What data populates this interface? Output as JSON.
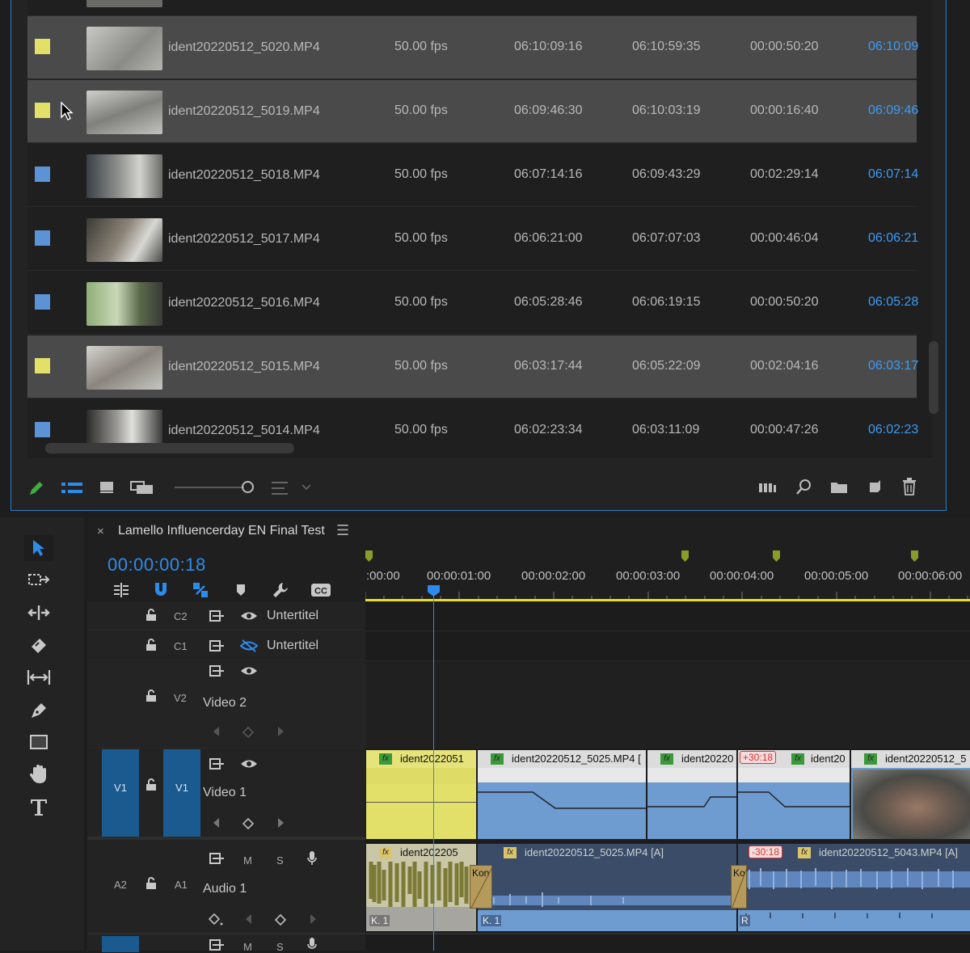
{
  "project": {
    "rows": [
      {
        "label": "yellow",
        "name": "ident20220512_5020.MP4",
        "fps": "50.00 fps",
        "media_start": "06:10:09:16",
        "media_end": "06:10:59:35",
        "duration": "00:00:50:20",
        "video_in": "06:10:09",
        "selected": true
      },
      {
        "label": "yellow",
        "name": "ident20220512_5019.MP4",
        "fps": "50.00 fps",
        "media_start": "06:09:46:30",
        "media_end": "06:10:03:19",
        "duration": "00:00:16:40",
        "video_in": "06:09:46",
        "selected": true
      },
      {
        "label": "blue",
        "name": "ident20220512_5018.MP4",
        "fps": "50.00 fps",
        "media_start": "06:07:14:16",
        "media_end": "06:09:43:29",
        "duration": "00:02:29:14",
        "video_in": "06:07:14",
        "selected": false
      },
      {
        "label": "blue",
        "name": "ident20220512_5017.MP4",
        "fps": "50.00 fps",
        "media_start": "06:06:21:00",
        "media_end": "06:07:07:03",
        "duration": "00:00:46:04",
        "video_in": "06:06:21",
        "selected": false
      },
      {
        "label": "blue",
        "name": "ident20220512_5016.MP4",
        "fps": "50.00 fps",
        "media_start": "06:05:28:46",
        "media_end": "06:06:19:15",
        "duration": "00:00:50:20",
        "video_in": "06:05:28",
        "selected": false
      },
      {
        "label": "yellow",
        "name": "ident20220512_5015.MP4",
        "fps": "50.00 fps",
        "media_start": "06:03:17:44",
        "media_end": "06:05:22:09",
        "duration": "00:02:04:16",
        "video_in": "06:03:17",
        "selected": true
      },
      {
        "label": "blue",
        "name": "ident20220512_5014.MP4",
        "fps": "50.00 fps",
        "media_start": "06:02:23:34",
        "media_end": "06:03:11:09",
        "duration": "00:00:47:26",
        "video_in": "06:02:23",
        "selected": false
      }
    ],
    "colors": {
      "yellow": "#e3e06a",
      "blue": "#5b93d6",
      "accent": "#2d8ceb"
    }
  },
  "sequence": {
    "title": "Lamello Influencerday EN Final Test",
    "close": "×",
    "menu": "☰",
    "timecode": "00:00:00:18",
    "ruler": [
      ":00:00",
      "00:00:01:00",
      "00:00:02:00",
      "00:00:03:00",
      "00:00:04:00",
      "00:00:05:00",
      "00:00:06:00"
    ]
  },
  "tracks": {
    "c2": {
      "id": "C2",
      "name": "Untertitel"
    },
    "c1": {
      "id": "C1",
      "name": "Untertitel"
    },
    "v2": {
      "id": "V2",
      "name": "Video 2"
    },
    "v1": {
      "src": "V1",
      "id": "V1",
      "name": "Video 1"
    },
    "a1": {
      "src": "A2",
      "id": "A1",
      "name": "Audio 1",
      "m": "M",
      "s": "S"
    },
    "a2": {
      "m": "M",
      "s": "S"
    }
  },
  "clips": {
    "v1": [
      {
        "title": "ident2022051"
      },
      {
        "title": "ident20220512_5025.MP4 ["
      },
      {
        "title": "ident20220"
      },
      {
        "title": "ident20"
      },
      {
        "title": "ident20220512_5"
      }
    ],
    "v1_tag": "+30:18",
    "a1": [
      {
        "title": "ident202205"
      },
      {
        "title": "ident20220512_5025.MP4 [A]"
      },
      {
        "title": "ident20220512_5043.MP4 [A]"
      }
    ],
    "a1_tag": "-30:18",
    "transition1": "Kon",
    "transition2": "Ko",
    "k1a": "K. 1",
    "k1b": "K. 1",
    "r": "R"
  }
}
